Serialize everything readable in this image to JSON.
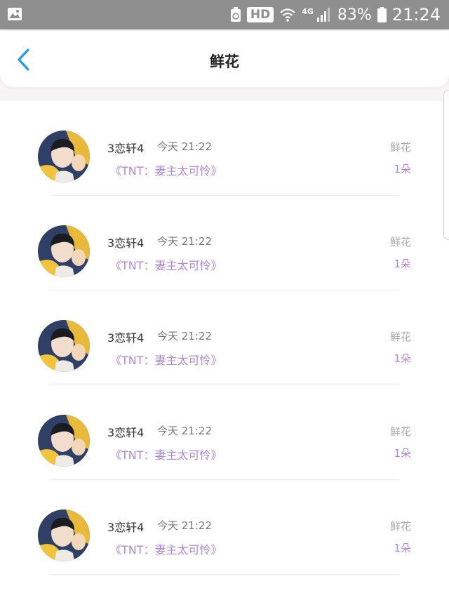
{
  "status_bar": {
    "hd_label": "HD",
    "network_label": "4G",
    "battery_percent": "83%",
    "time": "21:24"
  },
  "header": {
    "title": "鲜花"
  },
  "colors": {
    "accent_blue": "#1f9af0",
    "book_purple": "#b087e0"
  },
  "items": [
    {
      "name": "3恋轩4",
      "time": "今天 21:22",
      "book": "《TNT：妻主太可怜》",
      "gift": "鲜花",
      "count": "1朵"
    },
    {
      "name": "3恋轩4",
      "time": "今天 21:22",
      "book": "《TNT：妻主太可怜》",
      "gift": "鲜花",
      "count": "1朵"
    },
    {
      "name": "3恋轩4",
      "time": "今天 21:22",
      "book": "《TNT：妻主太可怜》",
      "gift": "鲜花",
      "count": "1朵"
    },
    {
      "name": "3恋轩4",
      "time": "今天 21:22",
      "book": "《TNT：妻主太可怜》",
      "gift": "鲜花",
      "count": "1朵"
    },
    {
      "name": "3恋轩4",
      "time": "今天 21:22",
      "book": "《TNT：妻主太可怜》",
      "gift": "鲜花",
      "count": "1朵"
    }
  ]
}
